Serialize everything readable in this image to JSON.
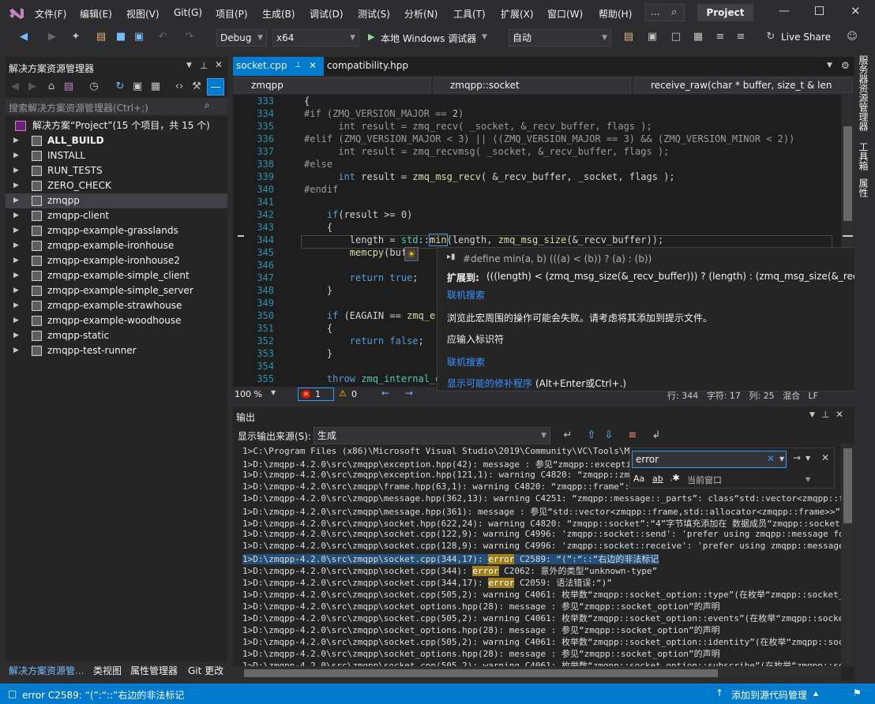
{
  "menubar": {
    "logo": "vs-logo-icon",
    "items": [
      "文件(F)",
      "编辑(E)",
      "视图(V)",
      "Git(G)",
      "项目(P)",
      "生成(B)",
      "调试(D)",
      "测试(S)",
      "分析(N)",
      "工具(T)",
      "扩展(X)",
      "窗口(W)",
      "帮助(H)"
    ],
    "search_glyph": "...",
    "project_name": "Project"
  },
  "toolbar": {
    "config": "Debug",
    "platform": "x64",
    "run_label": "本地 Windows 调试器",
    "auto": "自动",
    "live_share": "Live Share"
  },
  "solution": {
    "title": "解决方案资源管理器",
    "search_placeholder": "搜索解决方案资源管理器(Ctrl+;)",
    "root": "解决方案“Project”(15 个项目，共 15 个)",
    "items": [
      {
        "label": "ALL_BUILD",
        "bold": true
      },
      {
        "label": "INSTALL",
        "bold": false
      },
      {
        "label": "RUN_TESTS",
        "bold": false
      },
      {
        "label": "ZERO_CHECK",
        "bold": false
      },
      {
        "label": "zmqpp",
        "bold": false
      },
      {
        "label": "zmqpp-client",
        "bold": false
      },
      {
        "label": "zmqpp-example-grasslands",
        "bold": false
      },
      {
        "label": "zmqpp-example-ironhouse",
        "bold": false
      },
      {
        "label": "zmqpp-example-ironhouse2",
        "bold": false
      },
      {
        "label": "zmqpp-example-simple_client",
        "bold": false
      },
      {
        "label": "zmqpp-example-simple_server",
        "bold": false
      },
      {
        "label": "zmqpp-example-strawhouse",
        "bold": false
      },
      {
        "label": "zmqpp-example-woodhouse",
        "bold": false
      },
      {
        "label": "zmqpp-static",
        "bold": false
      },
      {
        "label": "zmqpp-test-runner",
        "bold": false
      }
    ],
    "bottom_tabs": [
      "解决方案资源管...",
      "类视图",
      "属性管理器",
      "Git 更改"
    ]
  },
  "editor": {
    "tabs": [
      "socket.cpp",
      "compatibility.hpp"
    ],
    "nav": [
      "zmqpp",
      "zmqpp::socket",
      "receive_raw(char * buffer, size_t & len"
    ],
    "line_numbers": [
      "333",
      "334",
      "335",
      "336",
      "337",
      "338",
      "339",
      "340",
      "341",
      "342",
      "343",
      "344",
      "345",
      "346",
      "347",
      "348",
      "349",
      "350",
      "351",
      "352",
      "353",
      "354",
      "355"
    ],
    "zoom": "100 %",
    "errors": "1",
    "warnings": "0",
    "status_right": "行: 344   字符: 17   列: 25   混合   LF"
  },
  "tooltip": {
    "define": "#define min(a, b) (((a) < (b)) ? (a) : (b))",
    "expand_label": "扩展到:",
    "expand_value": "(((length) < (zmq_msg_size(&_recv_buffer))) ? (length) : (zmq_msg_size(&_recv_buffer)))",
    "link1": "联机搜索",
    "message": "浏览此宏周围的操作可能会失败。请考虑将其添加到提示文件。",
    "error_text": "应输入标识符",
    "link2": "联机搜索",
    "fix": "显示可能的修补程序",
    "fix_keys": "(Alt+Enter或Ctrl+.)"
  },
  "output": {
    "title": "输出",
    "source_label": "显示输出来源(S):",
    "source_value": "生成",
    "find_value": "error",
    "find_scope": "当前窗口",
    "lines": [
      "1>C:\\Program Files (x86)\\Microsoft Visual Studio\\2019\\Community\\VC\\Tools\\MSVC\\",
      "1>D:\\zmqpp-4.2.0\\src\\zmqpp\\exception.hpp(42): message : 参见“zmqpp::exception",
      "1>D:\\zmqpp-4.2.0\\src\\zmqpp\\exception.hpp(121,1): warning C4820: “zmqpp::zmq_i",
      "1>D:\\zmqpp-4.2.0\\src\\zmqpp\\frame.hpp(63,1): warning C4820: “zmqpp::frame”: ",
      "1>D:\\zmqpp-4.2.0\\src\\zmqpp\\message.hpp(362,13): warning C4251: “zmqpp::message::_parts”: class“std::vector<zmqpp::frame,st",
      "1>D:\\zmqpp-4.2.0\\src\\zmqpp\\message.hpp(361): message : 参见“std::vector<zmqpp::frame,std::allocator<zmqpp::frame>>”的声明",
      "1>D:\\zmqpp-4.2.0\\src\\zmqpp\\socket.hpp(622,24): warning C4820: “zmqpp::socket”:“4”字节填充添加在 数据成员“zmqpp::socket::",
      "1>D:\\zmqpp-4.2.0\\src\\zmqpp\\socket.cpp(122,9): warning C4996: 'zmqpp::socket::send': 'prefer using zmqpp::message for multipar",
      "1>D:\\zmqpp-4.2.0\\src\\zmqpp\\socket.cpp(128,9): warning C4996: 'zmqpp::socket::receive': 'prefer using zmqpp::message for multi",
      "1>D:\\zmqpp-4.2.0\\src\\zmqpp\\socket.cpp(344,17): ",
      "1>D:\\zmqpp-4.2.0\\src\\zmqpp\\socket.cpp(344): ",
      "1>D:\\zmqpp-4.2.0\\src\\zmqpp\\socket.cpp(344,17): ",
      "1>D:\\zmqpp-4.2.0\\src\\zmqpp\\socket.cpp(505,2): warning C4061: 枚举数“zmqpp::socket_option::type”(在枚举“zmqpp::socket_optio",
      "1>D:\\zmqpp-4.2.0\\src\\zmqpp\\socket_options.hpp(28): message : 参见“zmqpp::socket_option”的声明",
      "1>D:\\zmqpp-4.2.0\\src\\zmqpp\\socket.cpp(505,2): warning C4061: 枚举数“zmqpp::socket_option::events”(在枚举“zmqpp::socket_opt",
      "1>D:\\zmqpp-4.2.0\\src\\zmqpp\\socket_options.hpp(28): message : 参见“zmqpp::socket_option”的声明",
      "1>D:\\zmqpp-4.2.0\\src\\zmqpp\\socket.cpp(505,2): warning C4061: 枚举数“zmqpp::socket_option::identity”(在枚举“zmqpp::socket_o",
      "1>D:\\zmqpp-4.2.0\\src\\zmqpp\\socket_options.hpp(28): message : 参见“zmqpp::socket_option”的声明",
      "1>D:\\zmqpp-4.2.0\\src\\zmqpp\\socket.cpp(505,2): warning C4061: 枚举数“zmqpp::socket_option::subscribe”(在枚举“zmqpp::socket"
    ],
    "err1_tag": "error",
    "err1_rest": " C2589: “(”:“::”右边的非法标记",
    "err2_tag": "error",
    "err2_rest": " C2062: 意外的类型“unknown-type”",
    "err3_tag": "error",
    "err3_rest": " C2059: 语法错误:“)”"
  },
  "right_rail": [
    "服务器资源管理器",
    "工具箱",
    "属性"
  ],
  "statusbar": {
    "message": "error C2589: “(”:“::”右边的非法标记",
    "source_control": "添加到源代码管理"
  },
  "colors": {
    "accent": "#007acc",
    "error_highlight": "#a0801e",
    "selection": "#264f78"
  }
}
